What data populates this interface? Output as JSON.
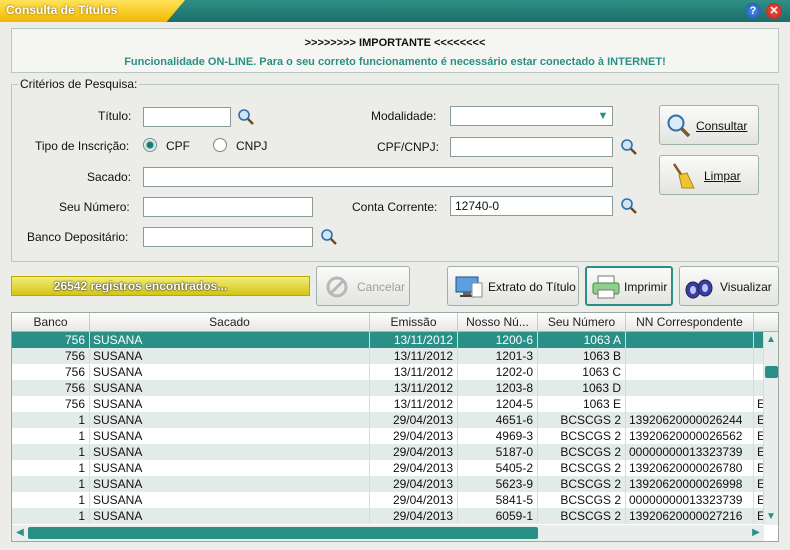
{
  "window": {
    "title": "Consulta de Títulos",
    "help_label": "?",
    "close_label": "✕"
  },
  "notice": {
    "line1": ">>>>>>>> IMPORTANTE <<<<<<<<",
    "line2": "Funcionalidade ON-LINE. Para o seu correto funcionamento é necessário estar conectado à INTERNET!"
  },
  "criteria": {
    "legend": "Critérios de Pesquisa:",
    "titulo_label": "Título:",
    "titulo_value": "",
    "tipo_label": "Tipo de Inscrição:",
    "cpf_label": "CPF",
    "cnpj_label": "CNPJ",
    "selected_tipo": "CPF",
    "sacado_label": "Sacado:",
    "sacado_value": "",
    "seu_numero_label": "Seu Número:",
    "seu_numero_value": "",
    "banco_label": "Banco Depositário:",
    "banco_value": "",
    "modalidade_label": "Modalidade:",
    "modalidade_value": "",
    "cpfcnpj_label": "CPF/CNPJ:",
    "cpfcnpj_value": "",
    "conta_label": "Conta Corrente:",
    "conta_value": "12740-0"
  },
  "buttons": {
    "consultar": "Consultar",
    "limpar": "Limpar",
    "cancelar": "Cancelar",
    "extrato": "Extrato do Título",
    "imprimir": "Imprimir",
    "visualizar": "Visualizar"
  },
  "status": {
    "count_text": "26542 registros encontrados..."
  },
  "table": {
    "columns": [
      "Banco",
      "Sacado",
      "Emissão",
      "Nosso Nú...",
      "Seu Número",
      "NN Correspondente",
      ""
    ],
    "rows": [
      [
        "756",
        "SUSANA",
        "13/11/2012",
        "1200-6",
        "1063 A",
        "",
        ""
      ],
      [
        "756",
        "SUSANA",
        "13/11/2012",
        "1201-3",
        "1063 B",
        "",
        ""
      ],
      [
        "756",
        "SUSANA",
        "13/11/2012",
        "1202-0",
        "1063 C",
        "",
        ""
      ],
      [
        "756",
        "SUSANA",
        "13/11/2012",
        "1203-8",
        "1063 D",
        "",
        ""
      ],
      [
        "756",
        "SUSANA",
        "13/11/2012",
        "1204-5",
        "1063 E",
        "",
        "E"
      ],
      [
        "1",
        "SUSANA",
        "29/04/2013",
        "4651-6",
        "BCSCGS 2",
        "13920620000026244",
        "E"
      ],
      [
        "1",
        "SUSANA",
        "29/04/2013",
        "4969-3",
        "BCSCGS 2",
        "13920620000026562",
        "E"
      ],
      [
        "1",
        "SUSANA",
        "29/04/2013",
        "5187-0",
        "BCSCGS 2",
        "00000000013323739",
        "E"
      ],
      [
        "1",
        "SUSANA",
        "29/04/2013",
        "5405-2",
        "BCSCGS 2",
        "13920620000026780",
        "E"
      ],
      [
        "1",
        "SUSANA",
        "29/04/2013",
        "5623-9",
        "BCSCGS 2",
        "13920620000026998",
        "E"
      ],
      [
        "1",
        "SUSANA",
        "29/04/2013",
        "5841-5",
        "BCSCGS 2",
        "00000000013323739",
        "E"
      ],
      [
        "1",
        "SUSANA",
        "29/04/2013",
        "6059-1",
        "BCSCGS 2",
        "13920620000027216",
        "E"
      ]
    ]
  },
  "colors": {
    "accent": "#2a8f86",
    "title_tab": "#f2b800",
    "status_bar": "#d3c514"
  }
}
